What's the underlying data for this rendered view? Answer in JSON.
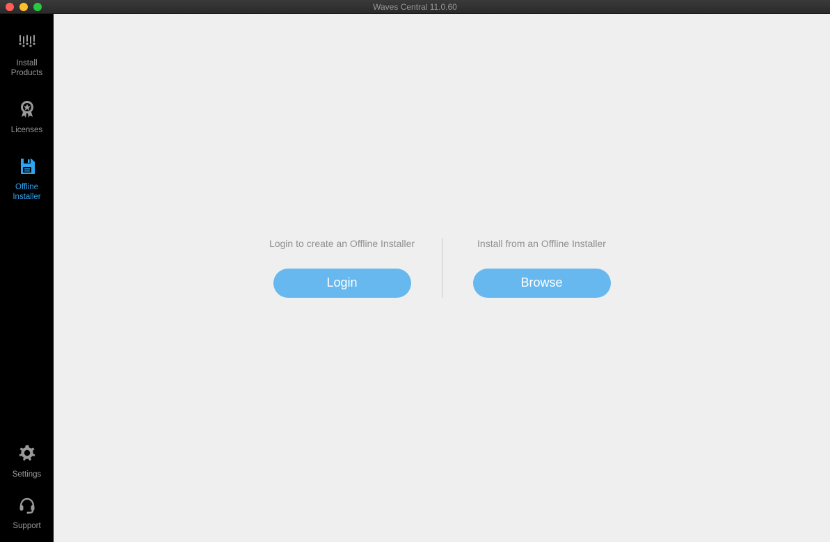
{
  "window": {
    "title": "Waves Central 11.0.60"
  },
  "sidebar": {
    "items": [
      {
        "label": "Install\nProducts"
      },
      {
        "label": "Licenses"
      },
      {
        "label": "Offline\nInstaller"
      }
    ],
    "bottom_items": [
      {
        "label": "Settings"
      },
      {
        "label": "Support"
      }
    ]
  },
  "main": {
    "left": {
      "text": "Login to create an Offline Installer",
      "button": "Login"
    },
    "right": {
      "text": "Install from an Offline Installer",
      "button": "Browse"
    }
  }
}
